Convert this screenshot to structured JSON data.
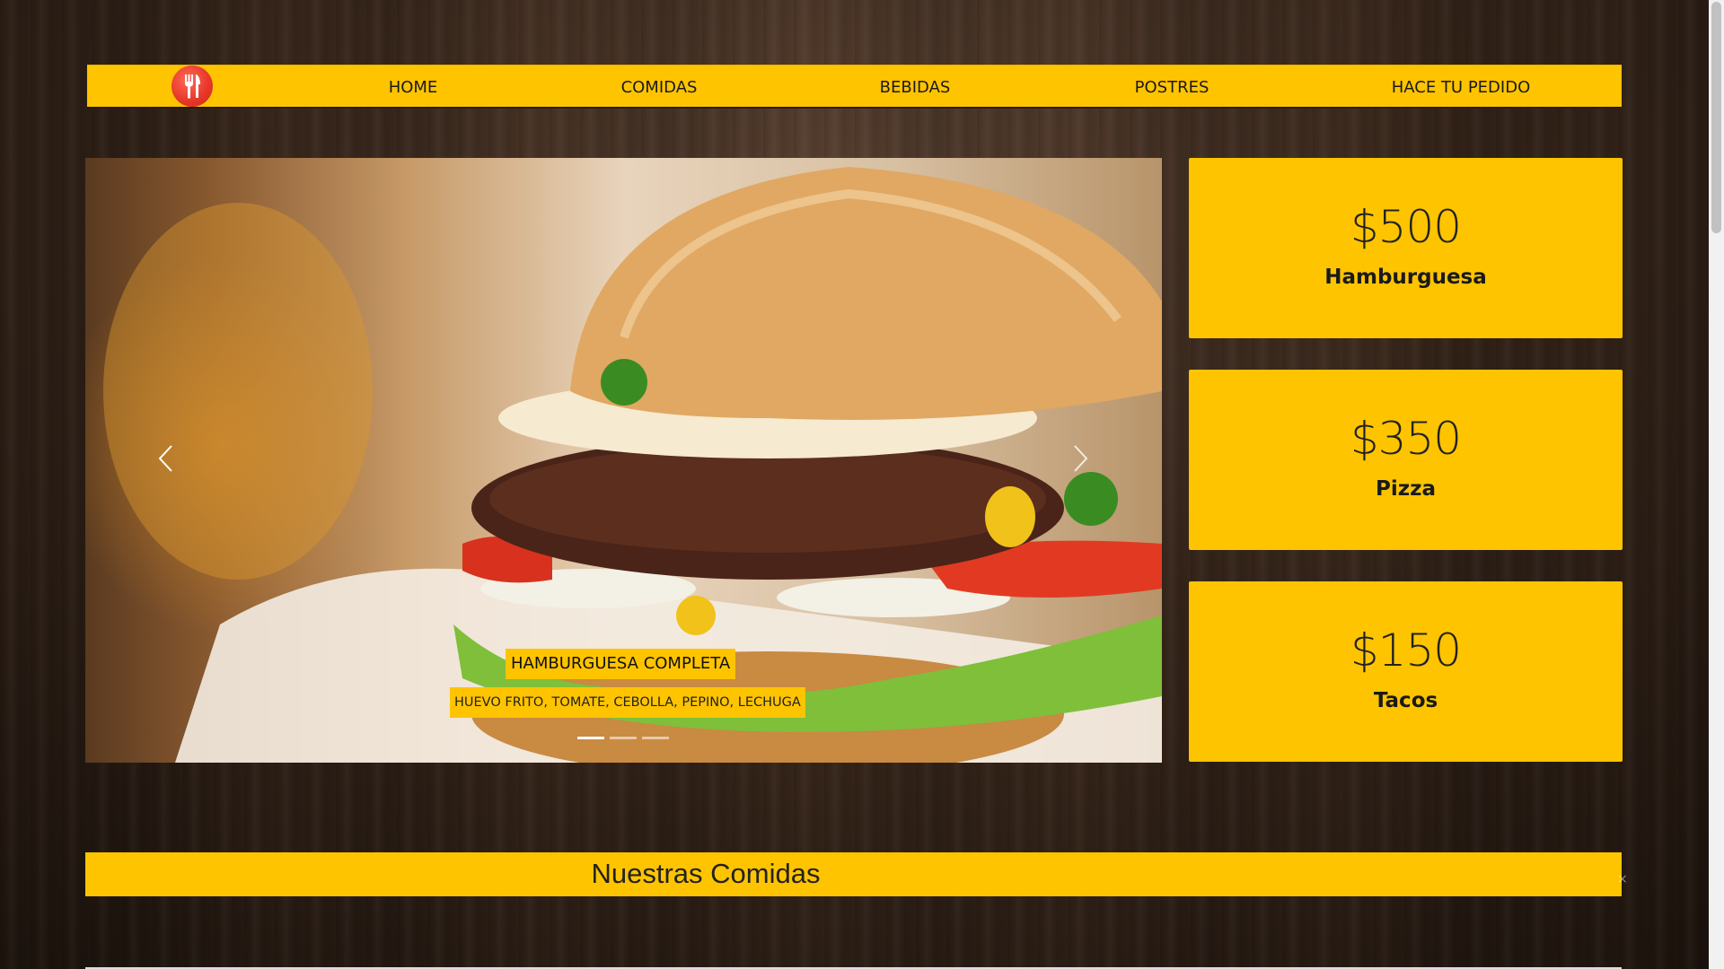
{
  "nav": {
    "logo_icon": "fork-knife-icon",
    "items": [
      {
        "label": "HOME"
      },
      {
        "label": "COMIDAS"
      },
      {
        "label": "BEBIDAS"
      },
      {
        "label": "POSTRES"
      },
      {
        "label": "HACE TU PEDIDO"
      }
    ]
  },
  "carousel": {
    "caption_title": "HAMBURGUESA COMPLETA",
    "caption_subtitle": "HUEVO FRITO, TOMATE, CEBOLLA, PEPINO, LECHUGA",
    "indicator_count": 3,
    "active_indicator": 1,
    "prev_icon": "chevron-left-icon",
    "next_icon": "chevron-right-icon"
  },
  "cards": [
    {
      "price": "$500",
      "name": "Hamburguesa"
    },
    {
      "price": "$350",
      "name": "Pizza"
    },
    {
      "price": "$150",
      "name": "Tacos"
    }
  ],
  "section": {
    "title": "Nuestras Comidas"
  },
  "colors": {
    "accent": "#ffc400",
    "logo_red": "#e8392a",
    "text_dark": "#1a1a1a"
  }
}
